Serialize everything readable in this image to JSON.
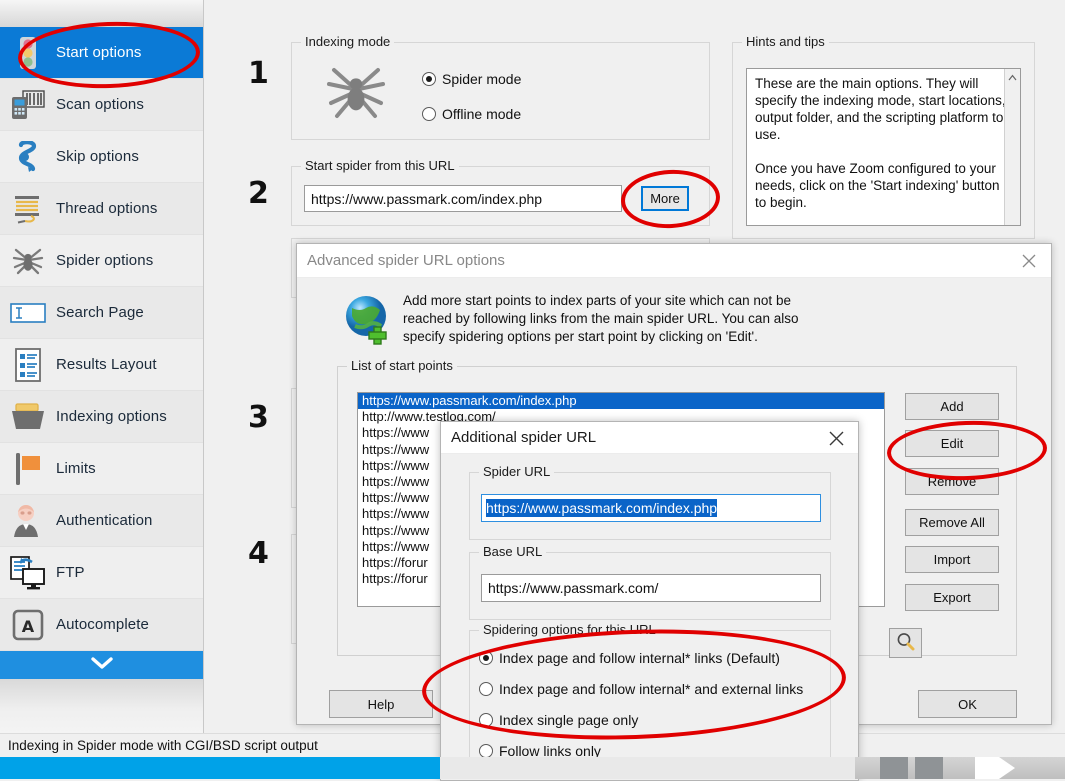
{
  "sidebar": {
    "items": [
      {
        "label": "Start options",
        "icon": "traffic-light-icon",
        "selected": true
      },
      {
        "label": "Scan options",
        "icon": "scanner-icon",
        "selected": false
      },
      {
        "label": "Skip options",
        "icon": "skip-arrow-icon",
        "selected": false
      },
      {
        "label": "Thread options",
        "icon": "thread-spool-icon",
        "selected": false
      },
      {
        "label": "Spider options",
        "icon": "spider-icon",
        "selected": false
      },
      {
        "label": "Search Page",
        "icon": "text-field-icon",
        "selected": false
      },
      {
        "label": "Results Layout",
        "icon": "document-list-icon",
        "selected": false
      },
      {
        "label": "Indexing options",
        "icon": "folder-icon",
        "selected": false
      },
      {
        "label": "Limits",
        "icon": "flag-icon",
        "selected": false
      },
      {
        "label": "Authentication",
        "icon": "user-icon",
        "selected": false
      },
      {
        "label": "FTP",
        "icon": "ftp-transfer-icon",
        "selected": false
      },
      {
        "label": "Autocomplete",
        "icon": "key-a-icon",
        "selected": false
      }
    ],
    "more_icon": "chevron-down-icon",
    "selected_bg": "#0b7ad6",
    "more_bg": "#1f8fe0"
  },
  "steps": {
    "one": "1",
    "two": "2",
    "three": "3",
    "four": "4"
  },
  "indexing_mode": {
    "caption": "Indexing mode",
    "icon": "spider-icon",
    "options": [
      {
        "label": "Spider mode",
        "checked": true
      },
      {
        "label": "Offline mode",
        "checked": false
      }
    ]
  },
  "start_url": {
    "caption": "Start spider from this URL",
    "value": "https://www.passmark.com/index.php",
    "more_label": "More"
  },
  "hints": {
    "caption": "Hints and tips",
    "text": "These are the main options. They will specify the indexing mode, start locations, output folder, and the scripting platform to use.\n\nOnce you have Zoom configured to your needs, click on the 'Start indexing' button to begin.",
    "scroll_up_icon": "chevron-up-icon"
  },
  "statusbar": {
    "text": "Indexing in Spider mode with CGI/BSD script output"
  },
  "advanced_dialog": {
    "title": "Advanced spider URL options",
    "close_icon": "close-icon",
    "globe_icon": "globe-add-icon",
    "description": "Add more start points to index parts of your site which can not be reached by following links from the main spider URL. You can also specify spidering options per start point by clicking on 'Edit'.",
    "list_caption": "List of start points",
    "list_items": [
      {
        "text": "https://www.passmark.com/index.php",
        "selected": true
      },
      {
        "text": "http://www.testlog.com/",
        "selected": false
      },
      {
        "text": "https://www",
        "selected": false
      },
      {
        "text": "https://www",
        "selected": false
      },
      {
        "text": "https://www",
        "selected": false
      },
      {
        "text": "https://www",
        "selected": false
      },
      {
        "text": "https://www",
        "selected": false
      },
      {
        "text": "https://www",
        "selected": false
      },
      {
        "text": "https://www",
        "selected": false
      },
      {
        "text": "https://www",
        "selected": false
      },
      {
        "text": "https://forur",
        "selected": false
      },
      {
        "text": "https://forur",
        "selected": false
      }
    ],
    "buttons": [
      "Add",
      "Edit",
      "Remove",
      "Remove All",
      "Import",
      "Export"
    ],
    "search_icon": "magnifier-icon",
    "help_label": "Help",
    "ok_label": "OK"
  },
  "additional_dialog": {
    "title": "Additional spider URL",
    "close_icon": "close-icon",
    "spider_url": {
      "caption": "Spider URL",
      "value": "https://www.passmark.com/index.php",
      "selected": true
    },
    "base_url": {
      "caption": "Base URL",
      "value": "https://www.passmark.com/"
    },
    "spidering": {
      "caption": "Spidering options for this URL",
      "options": [
        {
          "label": "Index page and follow internal* links (Default)",
          "checked": true
        },
        {
          "label": "Index page and follow internal* and external links",
          "checked": false
        },
        {
          "label": "Index single page only",
          "checked": false
        },
        {
          "label": "Follow links only",
          "checked": false
        }
      ]
    }
  },
  "annotations": {
    "color": "#e00000",
    "targets": [
      "start-options-sidebar-item",
      "more-button",
      "edit-button",
      "spidering-options-group"
    ]
  }
}
